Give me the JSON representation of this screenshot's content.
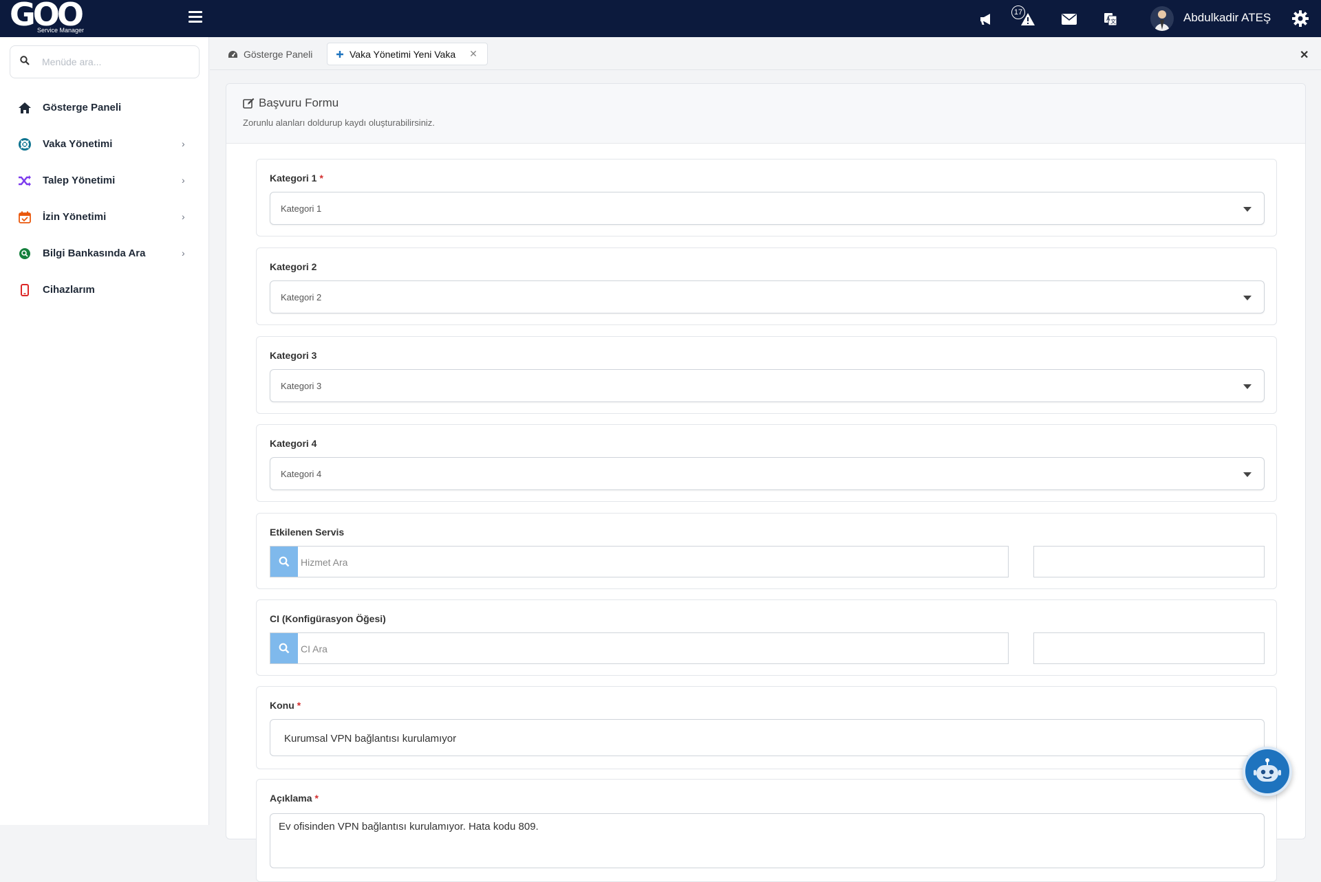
{
  "brand": {
    "logo_text": "GOO",
    "logo_subtitle": "Service Manager"
  },
  "topbar": {
    "notification_count": "17",
    "user_name": "Abdulkadir ATEŞ",
    "icons": [
      "menu-icon",
      "megaphone-icon",
      "warning-icon",
      "envelope-icon",
      "translate-icon",
      "gear-icon"
    ]
  },
  "sidebar": {
    "search_placeholder": "Menüde ara...",
    "items": [
      {
        "label": "Gösterge Paneli",
        "icon": "home-icon",
        "color": "#1f2937",
        "has_children": false
      },
      {
        "label": "Vaka Yönetimi",
        "icon": "lifebuoy-icon",
        "color": "#0e7490",
        "has_children": true
      },
      {
        "label": "Talep Yönetimi",
        "icon": "shuffle-icon",
        "color": "#7c3aed",
        "has_children": true
      },
      {
        "label": "İzin Yönetimi",
        "icon": "calendar-check-icon",
        "color": "#ea580c",
        "has_children": true
      },
      {
        "label": "Bilgi Bankasında Ara",
        "icon": "search-circle-icon",
        "color": "#15803d",
        "has_children": true
      },
      {
        "label": "Cihazlarım",
        "icon": "mobile-icon",
        "color": "#dc2626",
        "has_children": false
      }
    ]
  },
  "tabs": [
    {
      "label": "Gösterge Paneli",
      "icon": "dashboard-icon",
      "active": false
    },
    {
      "label": "Vaka Yönetimi Yeni Vaka",
      "icon": "plus-icon",
      "active": true,
      "closable": true
    }
  ],
  "form": {
    "title": "Başvuru Formu",
    "subtitle": "Zorunlu alanları doldurup kaydı oluşturabilirsiniz.",
    "fields": {
      "kategori1": {
        "label": "Kategori 1",
        "required": true,
        "value": "Kategori 1"
      },
      "kategori2": {
        "label": "Kategori 2",
        "required": false,
        "value": "Kategori 2"
      },
      "kategori3": {
        "label": "Kategori 3",
        "required": false,
        "value": "Kategori 3"
      },
      "kategori4": {
        "label": "Kategori 4",
        "required": false,
        "value": "Kategori 4"
      },
      "etkilenen_servis": {
        "label": "Etkilenen Servis",
        "placeholder": "Hizmet Ara"
      },
      "ci": {
        "label": "CI (Konfigürasyon Öğesi)",
        "placeholder": "CI Ara"
      },
      "konu": {
        "label": "Konu",
        "required": true,
        "value": "Kurumsal VPN bağlantısı kurulamıyor"
      },
      "aciklama": {
        "label": "Açıklama",
        "required": true,
        "value": "Ev ofisinden VPN bağlantısı kurulamıyor. Hata kodu 809."
      }
    },
    "required_mark": "*"
  },
  "colors": {
    "topbar": "#0c1a3d",
    "search_button": "#7fb9ec",
    "chatbot": "#1e73be",
    "required": "#d32f2f"
  }
}
